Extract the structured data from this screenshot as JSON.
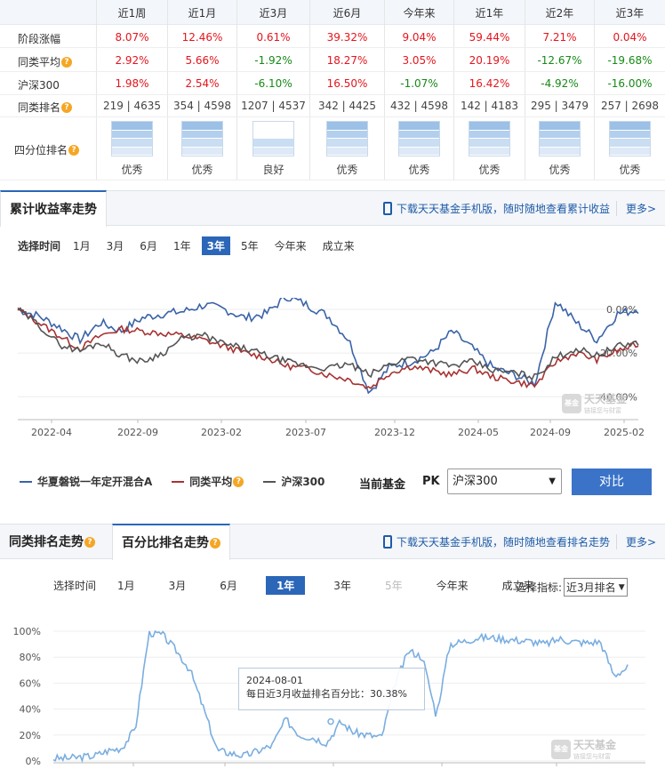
{
  "perf_table": {
    "periods": [
      "近1周",
      "近1月",
      "近3月",
      "近6月",
      "今年来",
      "近1年",
      "近2年",
      "近3年"
    ],
    "rows": [
      {
        "label": "阶段涨幅",
        "help": false,
        "values": [
          "8.07%",
          "12.46%",
          "0.61%",
          "39.32%",
          "9.04%",
          "59.44%",
          "7.21%",
          "0.04%"
        ],
        "colors": [
          "red",
          "red",
          "red",
          "red",
          "red",
          "red",
          "red",
          "red"
        ]
      },
      {
        "label": "同类平均",
        "help": true,
        "values": [
          "2.92%",
          "5.66%",
          "-1.92%",
          "18.27%",
          "3.05%",
          "20.19%",
          "-12.67%",
          "-19.68%"
        ],
        "colors": [
          "red",
          "red",
          "green",
          "red",
          "red",
          "red",
          "green",
          "green"
        ]
      },
      {
        "label": "沪深300",
        "help": false,
        "values": [
          "1.98%",
          "2.54%",
          "-6.10%",
          "16.50%",
          "-1.07%",
          "16.42%",
          "-4.92%",
          "-16.00%"
        ],
        "colors": [
          "red",
          "red",
          "green",
          "red",
          "green",
          "red",
          "green",
          "green"
        ]
      },
      {
        "label": "同类排名",
        "help": true,
        "values": [
          "219 | 4635",
          "354 | 4598",
          "1207 | 4537",
          "342 | 4425",
          "432 | 4598",
          "142 | 4183",
          "295 | 3479",
          "257 | 2698"
        ],
        "colors": [
          "gray",
          "gray",
          "gray",
          "gray",
          "gray",
          "gray",
          "gray",
          "gray"
        ]
      }
    ],
    "quartile_label": "四分位排名",
    "quartile_levels": [
      4,
      4,
      2,
      4,
      4,
      4,
      4,
      4
    ],
    "quartile_texts": [
      "优秀",
      "优秀",
      "良好",
      "优秀",
      "优秀",
      "优秀",
      "优秀",
      "优秀"
    ]
  },
  "cum_section": {
    "tab": "累计收益率走势",
    "download": "下载天天基金手机版，随时随地查看累计收益",
    "more": "更多>",
    "time_label": "选择时间",
    "time_options": [
      "1月",
      "3月",
      "6月",
      "1年",
      "3年",
      "5年",
      "今年来",
      "成立来"
    ],
    "time_active": "3年",
    "y_labels": [
      "0.00%",
      "-20.00%",
      "-40.00%"
    ],
    "x_labels": [
      "2022-04",
      "2022-09",
      "2023-02",
      "2023-07",
      "2023-12",
      "2024-05",
      "2024-09",
      "2025-02"
    ],
    "legend": [
      "华夏磐锐一年定开混合A",
      "同类平均",
      "沪深300"
    ],
    "legend_colors": [
      "#3a63a8",
      "#a83232",
      "#555555"
    ],
    "current_fund": "当前基金",
    "pk": "PK",
    "pk_select": "沪深300",
    "compare_btn": "对比"
  },
  "rank_section": {
    "tab1": "同类排名走势",
    "tab2": "百分比排名走势",
    "download": "下载天天基金手机版，随时随地查看排名走势",
    "more": "更多>",
    "time_label": "选择时间",
    "time_options": [
      "1月",
      "3月",
      "6月",
      "1年",
      "3年",
      "5年",
      "今年来",
      "成立来"
    ],
    "time_active": "1年",
    "time_disabled": [
      "5年"
    ],
    "indicator_label": "选择指标:",
    "indicator_value": "近3月排名",
    "y_labels": [
      "100%",
      "80%",
      "60%",
      "40%",
      "20%",
      "0%"
    ],
    "tooltip_date": "2024-08-01",
    "tooltip_text": "每日近3月收益排名百分比：30.38%",
    "line_color": "#7aaee0"
  },
  "watermark": {
    "name": "天天基金",
    "sub": "链接您与财富",
    "logo": "基金"
  }
}
